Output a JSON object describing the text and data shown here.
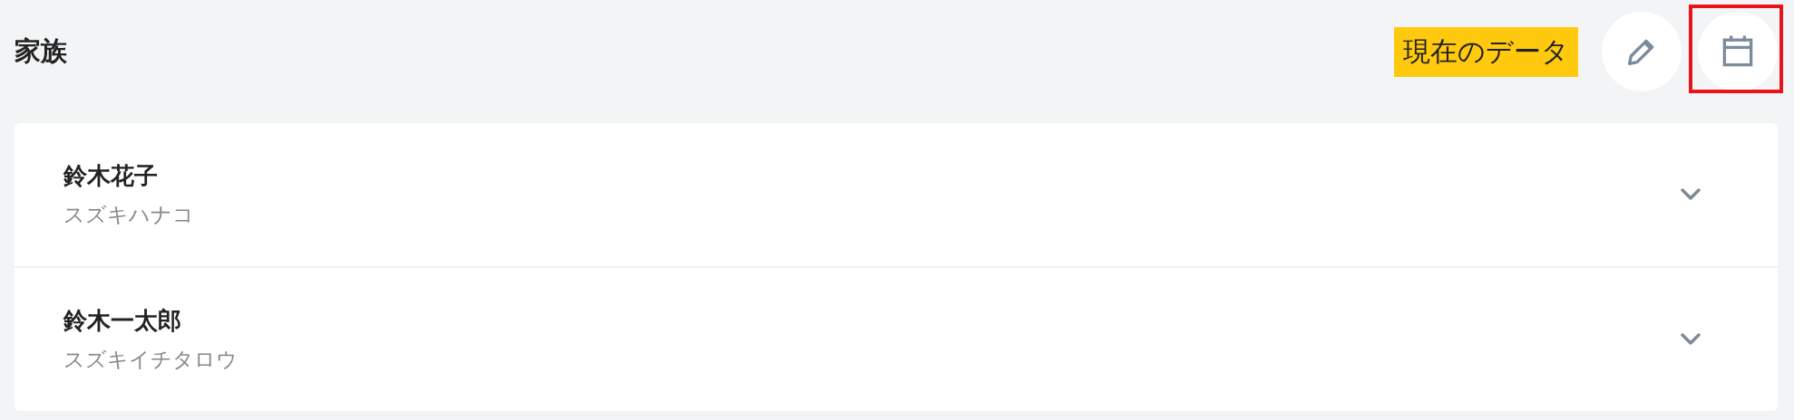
{
  "header": {
    "title": "家族",
    "badge": "現在のデータ",
    "buttons": [
      {
        "kind": "edit",
        "highlighted": false
      },
      {
        "kind": "calendar",
        "highlighted": true
      }
    ]
  },
  "members": [
    {
      "name": "鈴木花子",
      "kana": "スズキハナコ",
      "expanded": false
    },
    {
      "name": "鈴木一太郎",
      "kana": "スズキイチタロウ",
      "expanded": false
    }
  ]
}
